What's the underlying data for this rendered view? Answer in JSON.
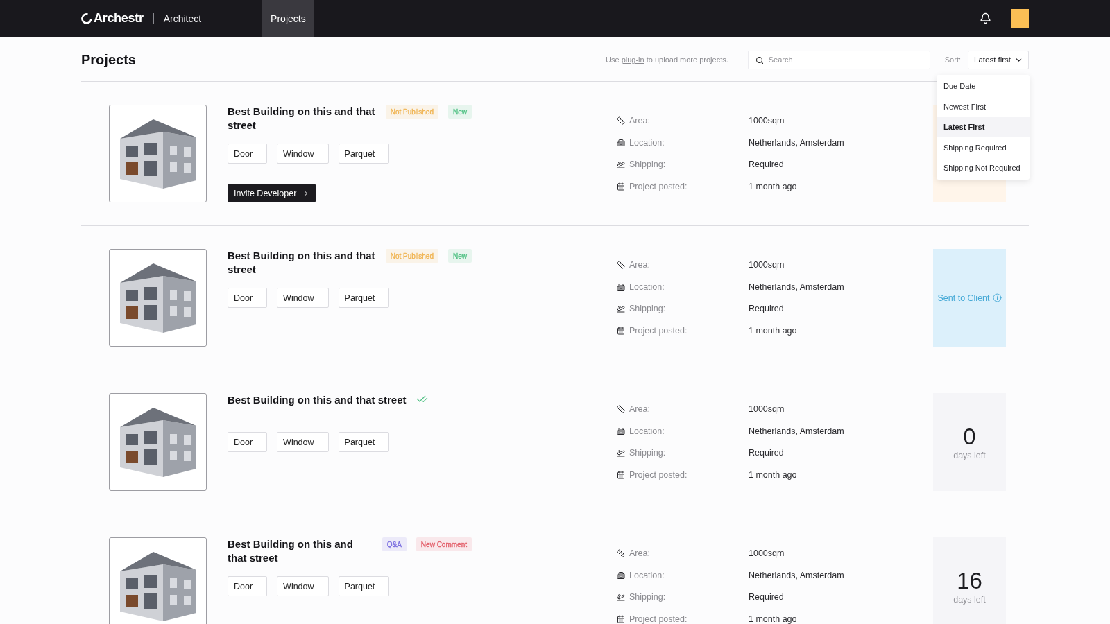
{
  "header": {
    "logo": "Archestr",
    "role": "Architect",
    "nav": [
      {
        "label": "Projects",
        "selected": true
      }
    ]
  },
  "toolbar": {
    "title": "Projects",
    "hint": {
      "before": "Use",
      "link": "plug-in",
      "after": "to upload more projects."
    },
    "search": {
      "placeholder": "Search"
    },
    "sort": {
      "label": "Sort:",
      "value": "Latest first",
      "expanded": true,
      "options": [
        {
          "label": "Due Date",
          "selected": false
        },
        {
          "label": "Newest First",
          "selected": false
        },
        {
          "label": "Latest First",
          "selected": true
        },
        {
          "label": "Shipping Required",
          "selected": false
        },
        {
          "label": "Shipping Not Required",
          "selected": false
        }
      ]
    }
  },
  "projects": [
    {
      "title": "Best Building on this and that street",
      "verified": false,
      "badges": [
        {
          "label": "Not Published",
          "color": "#f0b452"
        },
        {
          "label": "New",
          "color": "#52c285"
        }
      ],
      "tags": [
        "Door",
        "Window",
        "Parquet"
      ],
      "action": {
        "label": "Invite Developer"
      },
      "details": [
        {
          "kind": "area",
          "label": "Area:",
          "value": "1000sqm"
        },
        {
          "kind": "location",
          "label": "Location:",
          "value": "Netherlands, Amsterdam"
        },
        {
          "kind": "shipping",
          "label": "Shipping:",
          "value": "Required"
        },
        {
          "kind": "posted",
          "label": "Project posted:",
          "value": "1 month ago"
        }
      ],
      "status": {
        "kind": "pending"
      }
    },
    {
      "title": "Best Building on this and that street",
      "verified": false,
      "badges": [
        {
          "label": "Not Published",
          "color": "#f0b452"
        },
        {
          "label": "New",
          "color": "#52c285"
        }
      ],
      "tags": [
        "Door",
        "Window",
        "Parquet"
      ],
      "details": [
        {
          "kind": "area",
          "label": "Area:",
          "value": "1000sqm"
        },
        {
          "kind": "location",
          "label": "Location:",
          "value": "Netherlands, Amsterdam"
        },
        {
          "kind": "shipping",
          "label": "Shipping:",
          "value": "Required"
        },
        {
          "kind": "posted",
          "label": "Project posted:",
          "value": "1 month ago"
        }
      ],
      "status": {
        "kind": "sent",
        "label": "Sent to Client"
      }
    },
    {
      "title": "Best Building on this and that street",
      "verified": true,
      "tags": [
        "Door",
        "Window",
        "Parquet"
      ],
      "details": [
        {
          "kind": "area",
          "label": "Area:",
          "value": "1000sqm"
        },
        {
          "kind": "location",
          "label": "Location:",
          "value": "Netherlands, Amsterdam"
        },
        {
          "kind": "shipping",
          "label": "Shipping:",
          "value": "Required"
        },
        {
          "kind": "posted",
          "label": "Project posted:",
          "value": "1 month ago"
        }
      ],
      "status": {
        "kind": "countdown",
        "count": "0",
        "label": "days left"
      }
    },
    {
      "title": "Best Building on this and that street",
      "verified": false,
      "badges": [
        {
          "label": "Q&A",
          "color": "#7b6fe0"
        },
        {
          "label": "New Comment",
          "color": "#e35d68"
        }
      ],
      "tags": [
        "Door",
        "Window",
        "Parquet"
      ],
      "details": [
        {
          "kind": "area",
          "label": "Area:",
          "value": "1000sqm"
        },
        {
          "kind": "location",
          "label": "Location:",
          "value": "Netherlands, Amsterdam"
        },
        {
          "kind": "shipping",
          "label": "Shipping:",
          "value": "Required"
        },
        {
          "kind": "posted",
          "label": "Project posted:",
          "value": "1 month ago"
        }
      ],
      "status": {
        "kind": "countdown",
        "count": "16",
        "label": "days left"
      }
    }
  ]
}
